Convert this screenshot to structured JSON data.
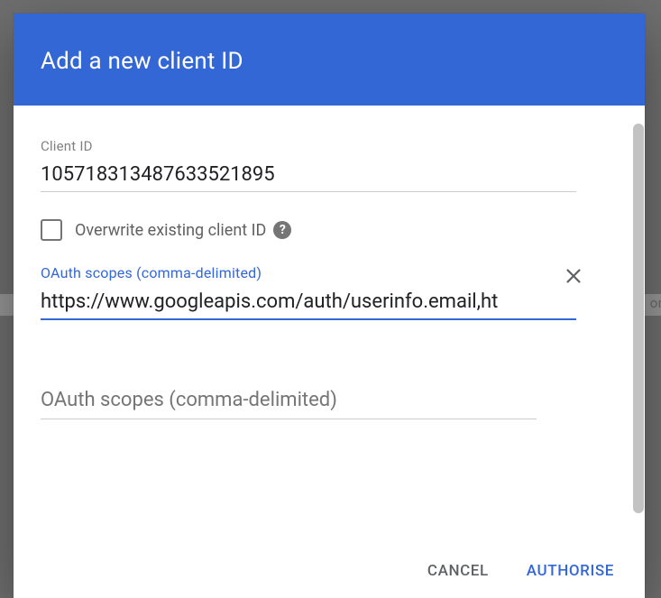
{
  "background": {
    "partial_text": "or"
  },
  "dialog": {
    "title": "Add a new client ID",
    "client_id": {
      "label": "Client ID",
      "value": "105718313487633521895"
    },
    "overwrite": {
      "label": "Overwrite existing client ID",
      "checked": false
    },
    "scopes_1": {
      "label": "OAuth scopes (comma-delimited)",
      "value": "https://www.googleapis.com/auth/userinfo.email,ht"
    },
    "scopes_2": {
      "placeholder": "OAuth scopes (comma-delimited)",
      "value": ""
    },
    "buttons": {
      "cancel": "CANCEL",
      "authorise": "AUTHORISE"
    }
  },
  "colors": {
    "primary": "#3367d6",
    "text": "#202124",
    "muted": "#757575"
  }
}
